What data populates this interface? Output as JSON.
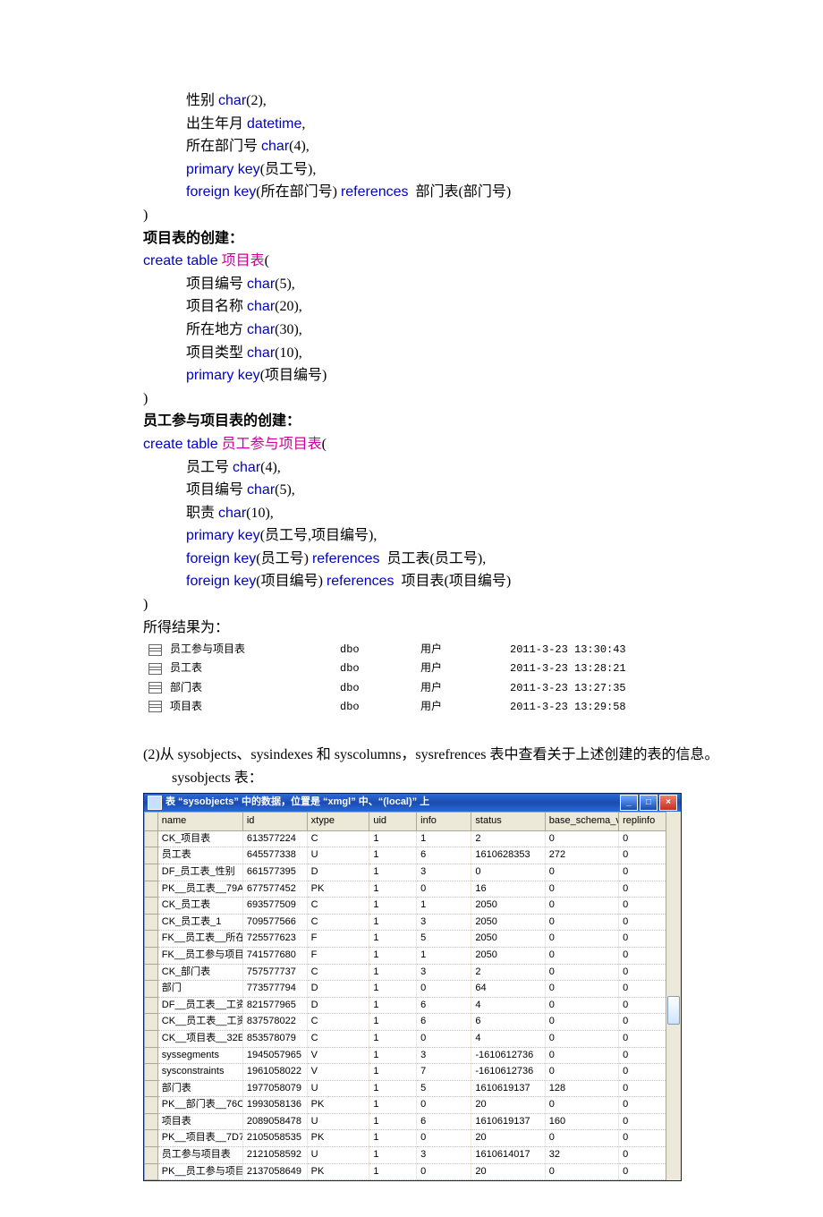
{
  "sql1": {
    "lines": [
      {
        "indent": 1,
        "parts": [
          {
            "t": "性别 ",
            "c": ""
          },
          {
            "t": "char",
            "c": "kw"
          },
          {
            "t": "(2),",
            "c": ""
          }
        ]
      },
      {
        "indent": 1,
        "parts": [
          {
            "t": "出生年月 ",
            "c": ""
          },
          {
            "t": "datetime",
            "c": "kw"
          },
          {
            "t": ",",
            "c": ""
          }
        ]
      },
      {
        "indent": 1,
        "parts": [
          {
            "t": "所在部门号 ",
            "c": ""
          },
          {
            "t": "char",
            "c": "kw"
          },
          {
            "t": "(4),",
            "c": ""
          }
        ]
      },
      {
        "indent": 1,
        "parts": [
          {
            "t": "primary key",
            "c": "kw"
          },
          {
            "t": "(员工号),",
            "c": ""
          }
        ]
      },
      {
        "indent": 1,
        "parts": [
          {
            "t": "foreign key",
            "c": "kw"
          },
          {
            "t": "(所在部门号) ",
            "c": ""
          },
          {
            "t": "references",
            "c": "kw"
          },
          {
            "t": "  部门表(部门号)",
            "c": ""
          }
        ]
      },
      {
        "indent": 0,
        "parts": [
          {
            "t": ")",
            "c": ""
          }
        ]
      }
    ]
  },
  "heading2": "项目表的创建：",
  "sql2": {
    "lines": [
      {
        "indent": 0,
        "parts": [
          {
            "t": "create table",
            "c": "kw"
          },
          {
            "t": "  ",
            "c": ""
          },
          {
            "t": "项目表",
            "c": "tbl-name"
          },
          {
            "t": "(",
            "c": ""
          }
        ]
      },
      {
        "indent": 1,
        "parts": [
          {
            "t": "项目编号 ",
            "c": ""
          },
          {
            "t": "char",
            "c": "kw"
          },
          {
            "t": "(5),",
            "c": ""
          }
        ]
      },
      {
        "indent": 1,
        "parts": [
          {
            "t": "项目名称 ",
            "c": ""
          },
          {
            "t": "char",
            "c": "kw"
          },
          {
            "t": "(20),",
            "c": ""
          }
        ]
      },
      {
        "indent": 1,
        "parts": [
          {
            "t": "所在地方 ",
            "c": ""
          },
          {
            "t": "char",
            "c": "kw"
          },
          {
            "t": "(30),",
            "c": ""
          }
        ]
      },
      {
        "indent": 1,
        "parts": [
          {
            "t": "项目类型 ",
            "c": ""
          },
          {
            "t": "char",
            "c": "kw"
          },
          {
            "t": "(10),",
            "c": ""
          }
        ]
      },
      {
        "indent": 1,
        "parts": [
          {
            "t": "primary key",
            "c": "kw"
          },
          {
            "t": "(项目编号)",
            "c": ""
          }
        ]
      },
      {
        "indent": 0,
        "parts": [
          {
            "t": ")",
            "c": ""
          }
        ]
      }
    ]
  },
  "heading3": "员工参与项目表的创建：",
  "sql3": {
    "lines": [
      {
        "indent": 0,
        "parts": [
          {
            "t": "create table",
            "c": "kw"
          },
          {
            "t": "  ",
            "c": ""
          },
          {
            "t": "员工参与项目表",
            "c": "tbl-name"
          },
          {
            "t": "(",
            "c": ""
          }
        ]
      },
      {
        "indent": 1,
        "parts": [
          {
            "t": "员工号 ",
            "c": ""
          },
          {
            "t": "char",
            "c": "kw"
          },
          {
            "t": "(4),",
            "c": ""
          }
        ]
      },
      {
        "indent": 1,
        "parts": [
          {
            "t": "项目编号 ",
            "c": ""
          },
          {
            "t": "char",
            "c": "kw"
          },
          {
            "t": "(5),",
            "c": ""
          }
        ]
      },
      {
        "indent": 1,
        "parts": [
          {
            "t": "职责 ",
            "c": ""
          },
          {
            "t": "char",
            "c": "kw"
          },
          {
            "t": "(10),",
            "c": ""
          }
        ]
      },
      {
        "indent": 1,
        "parts": [
          {
            "t": "primary key",
            "c": "kw"
          },
          {
            "t": "(员工号,项目编号),",
            "c": ""
          }
        ]
      },
      {
        "indent": 1,
        "parts": [
          {
            "t": "foreign key",
            "c": "kw"
          },
          {
            "t": "(员工号) ",
            "c": ""
          },
          {
            "t": "references",
            "c": "kw"
          },
          {
            "t": "  员工表(员工号),",
            "c": ""
          }
        ]
      },
      {
        "indent": 1,
        "parts": [
          {
            "t": "foreign key",
            "c": "kw"
          },
          {
            "t": "(项目编号) ",
            "c": ""
          },
          {
            "t": "references",
            "c": "kw"
          },
          {
            "t": "  项目表(项目编号)",
            "c": ""
          }
        ]
      },
      {
        "indent": 0,
        "parts": [
          {
            "t": ")",
            "c": ""
          }
        ]
      }
    ]
  },
  "result_heading": "所得结果为：",
  "result_rows": [
    {
      "name": "员工参与项目表",
      "owner": "dbo",
      "type": "用户",
      "date": "2011-3-23 13:30:43"
    },
    {
      "name": "员工表",
      "owner": "dbo",
      "type": "用户",
      "date": "2011-3-23 13:28:21"
    },
    {
      "name": "部门表",
      "owner": "dbo",
      "type": "用户",
      "date": "2011-3-23 13:27:35"
    },
    {
      "name": "项目表",
      "owner": "dbo",
      "type": "用户",
      "date": "2011-3-23 13:29:58"
    }
  ],
  "step2_text": "(2)从 sysobjects、sysindexes 和 syscolumns，sysrefrences 表中查看关于上述创建的表的信息。",
  "step2_sub": "sysobjects 表：",
  "window_title": "表 “sysobjects” 中的数据，位置是 “xmgl” 中、“(local)” 上",
  "grid_headers": [
    "name",
    "id",
    "xtype",
    "uid",
    "info",
    "status",
    "base_schema_ver",
    "replinfo"
  ],
  "grid_rows": [
    [
      "CK_项目表",
      "613577224",
      "C",
      "1",
      "1",
      "2",
      "0",
      "0"
    ],
    [
      "员工表",
      "645577338",
      "U",
      "1",
      "6",
      "1610628353",
      "272",
      "0"
    ],
    [
      "DF_员工表_性别",
      "661577395",
      "D",
      "1",
      "3",
      "0",
      "0",
      "0"
    ],
    [
      "PK__员工表__79A",
      "677577452",
      "PK",
      "1",
      "0",
      "16",
      "0",
      "0"
    ],
    [
      "CK_员工表",
      "693577509",
      "C",
      "1",
      "1",
      "2050",
      "0",
      "0"
    ],
    [
      "CK_员工表_1",
      "709577566",
      "C",
      "1",
      "3",
      "2050",
      "0",
      "0"
    ],
    [
      "FK__员工表__所在",
      "725577623",
      "F",
      "1",
      "5",
      "2050",
      "0",
      "0"
    ],
    [
      "FK__员工参与项目",
      "741577680",
      "F",
      "1",
      "1",
      "2050",
      "0",
      "0"
    ],
    [
      "CK_部门表",
      "757577737",
      "C",
      "1",
      "3",
      "2",
      "0",
      "0"
    ],
    [
      "部门",
      "773577794",
      "D",
      "1",
      "0",
      "64",
      "0",
      "0"
    ],
    [
      "DF__员工表__工资",
      "821577965",
      "D",
      "1",
      "6",
      "4",
      "0",
      "0"
    ],
    [
      "CK__员工表__工资",
      "837578022",
      "C",
      "1",
      "6",
      "6",
      "0",
      "0"
    ],
    [
      "CK__项目表__32E",
      "853578079",
      "C",
      "1",
      "0",
      "4",
      "0",
      "0"
    ],
    [
      "syssegments",
      "1945057965",
      "V",
      "1",
      "3",
      "-1610612736",
      "0",
      "0"
    ],
    [
      "sysconstraints",
      "1961058022",
      "V",
      "1",
      "7",
      "-1610612736",
      "0",
      "0"
    ],
    [
      "部门表",
      "1977058079",
      "U",
      "1",
      "5",
      "1610619137",
      "128",
      "0"
    ],
    [
      "PK__部门表__76C",
      "1993058136",
      "PK",
      "1",
      "0",
      "20",
      "0",
      "0"
    ],
    [
      "项目表",
      "2089058478",
      "U",
      "1",
      "6",
      "1610619137",
      "160",
      "0"
    ],
    [
      "PK__项目表__7D7",
      "2105058535",
      "PK",
      "1",
      "0",
      "20",
      "0",
      "0"
    ],
    [
      "员工参与项目表",
      "2121058592",
      "U",
      "1",
      "3",
      "1610614017",
      "32",
      "0"
    ],
    [
      "PK__员工参与项目",
      "2137058649",
      "PK",
      "1",
      "0",
      "20",
      "0",
      "0"
    ]
  ]
}
